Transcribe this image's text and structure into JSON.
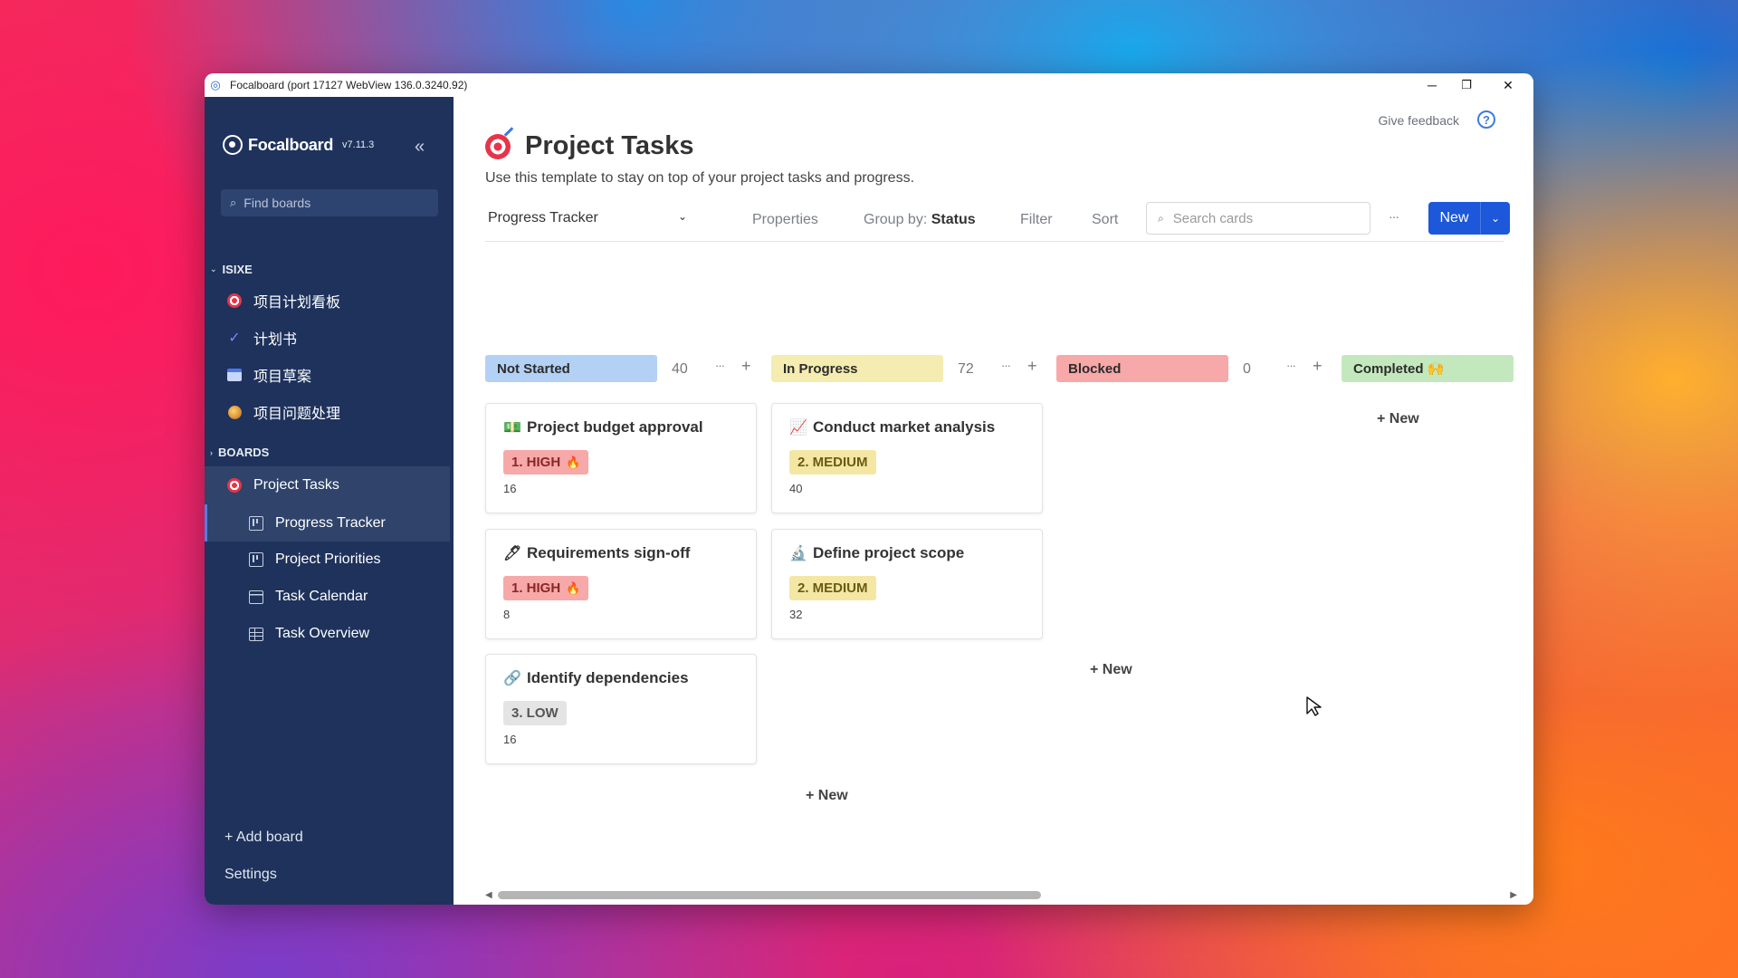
{
  "window": {
    "title": "Focalboard (port 17127 WebView 136.0.3240.92)",
    "controls": {
      "minimize": "─",
      "restore": "❐",
      "close": "✕"
    }
  },
  "sidebar": {
    "brand": "Focalboard",
    "version": "v7.11.3",
    "collapse_icon": "«",
    "search_placeholder": "Find boards",
    "workspace_section": "ISIXE",
    "workspace_items": [
      {
        "label": "项目计划看板",
        "icon": "target-icon"
      },
      {
        "label": "计划书",
        "icon": "check-icon"
      },
      {
        "label": "项目草案",
        "icon": "calendar-icon"
      },
      {
        "label": "项目问题处理",
        "icon": "bomb-icon"
      }
    ],
    "boards_section": "BOARDS",
    "board": {
      "label": "Project Tasks",
      "icon": "target-icon"
    },
    "views": [
      {
        "label": "Progress Tracker",
        "icon": "board-view-icon",
        "active": true
      },
      {
        "label": "Project Priorities",
        "icon": "board-view-icon"
      },
      {
        "label": "Task Calendar",
        "icon": "calendar-view-icon"
      },
      {
        "label": "Task Overview",
        "icon": "table-view-icon"
      }
    ],
    "add_board": "+ Add board",
    "settings": "Settings"
  },
  "header": {
    "give_feedback": "Give feedback",
    "help": "?",
    "title": "Project Tasks",
    "description": "Use this template to stay on top of your project tasks and progress."
  },
  "viewbar": {
    "view_name": "Progress Tracker",
    "properties": "Properties",
    "group_by_label": "Group by:",
    "group_by_value": "Status",
    "filter": "Filter",
    "sort": "Sort",
    "search_placeholder": "Search cards",
    "more": "···",
    "new": "New"
  },
  "columns": [
    {
      "label": "Not Started",
      "count": "40",
      "color": "#b3d1f5"
    },
    {
      "label": "In Progress",
      "count": "72",
      "color": "#f4ecb0"
    },
    {
      "label": "Blocked",
      "count": "0",
      "color": "#f7a8a8"
    },
    {
      "label": "Completed 🙌",
      "count": "",
      "color": "#c4e8bd"
    }
  ],
  "cards": [
    {
      "title": "Project budget approval",
      "emoji": "💵",
      "priority": "1. HIGH",
      "level": "high",
      "value": "16"
    },
    {
      "title": "Requirements sign-off",
      "emoji": "🖊",
      "priority": "1. HIGH",
      "level": "high",
      "value": "8"
    },
    {
      "title": "Identify dependencies",
      "emoji": "🔗",
      "priority": "3. LOW",
      "level": "low",
      "value": "16"
    },
    {
      "title": "Conduct market analysis",
      "emoji": "📈",
      "priority": "2. MEDIUM",
      "level": "medium",
      "value": "40"
    },
    {
      "title": "Define project scope",
      "emoji": "🔬",
      "priority": "2. MEDIUM",
      "level": "medium",
      "value": "32"
    }
  ],
  "add_new": "+ New",
  "flame": "🔥"
}
